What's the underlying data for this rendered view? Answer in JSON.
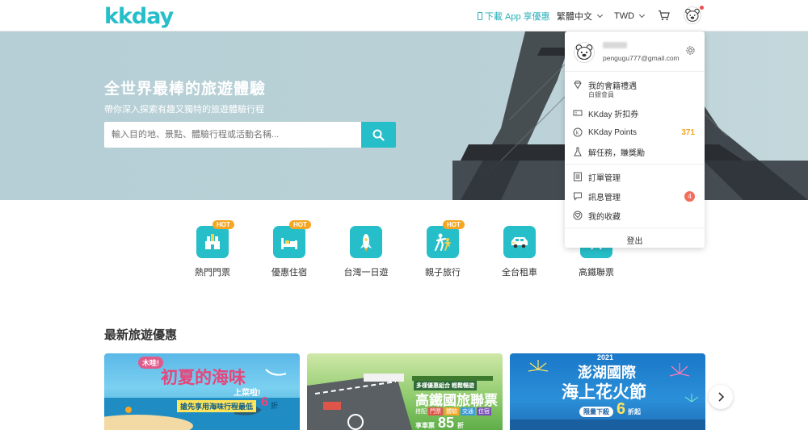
{
  "header": {
    "logo": "kkday",
    "download_app": "下載 App 享優惠",
    "language": "繁體中文",
    "currency": "TWD"
  },
  "hero": {
    "title": "全世界最棒的旅遊體驗",
    "subtitle": "帶你深入探索有趣又獨特的旅遊體驗行程",
    "search_placeholder": "輸入目的地、景點、體驗行程或活動名稱..."
  },
  "categories": [
    {
      "label": "熱門門票",
      "badge": "HOT",
      "icon": "ticket-castle-icon"
    },
    {
      "label": "優惠住宿",
      "badge": "HOT",
      "icon": "bed-icon"
    },
    {
      "label": "台灣一日遊",
      "badge": "",
      "icon": "rocket-icon"
    },
    {
      "label": "親子旅行",
      "badge": "HOT",
      "icon": "family-icon"
    },
    {
      "label": "全台租車",
      "badge": "",
      "icon": "car-icon"
    },
    {
      "label": "高鐵聯票",
      "badge": "",
      "icon": "train-icon"
    }
  ],
  "section": {
    "title": "最新旅遊優惠"
  },
  "cards": [
    {
      "title": "初夏的海味",
      "subtitle": "上菜啦!",
      "tag": "搶先享用海味行程最低",
      "discount": "6",
      "unit": "折",
      "bubble": "木哇!"
    },
    {
      "title": "高鐵國旅聯票",
      "subtitle": "多樣優惠組合 輕鬆暢遊",
      "tags": [
        "門票",
        "體驗",
        "交通",
        "住宿"
      ],
      "prefix": "搭配",
      "price_label": "享車票",
      "price": "85",
      "unit": "折"
    },
    {
      "year": "2021",
      "title_line1": "澎湖國際",
      "title_line2": "海上花火節",
      "tag": "限量下殺",
      "discount": "6",
      "unit": "折起"
    }
  ],
  "dropdown": {
    "email": "pengugu777@gmail.com",
    "items": [
      {
        "label": "我的會籍禮遇",
        "sub": "白銀會員",
        "icon": "diamond-icon"
      },
      {
        "label": "KKday 折扣券",
        "icon": "coupon-icon"
      },
      {
        "label": "KKday Points",
        "value": "371",
        "icon": "points-icon"
      },
      {
        "label": "解任務，賺獎勵",
        "icon": "flask-icon"
      },
      {
        "label": "訂單管理",
        "icon": "order-icon"
      },
      {
        "label": "訊息管理",
        "badge": "4",
        "icon": "message-icon"
      },
      {
        "label": "我的收藏",
        "icon": "favorite-icon"
      }
    ],
    "logout": "登出"
  },
  "colors": {
    "brand": "#26bec9",
    "hot": "#f5a623",
    "badge": "#f26d5b"
  }
}
